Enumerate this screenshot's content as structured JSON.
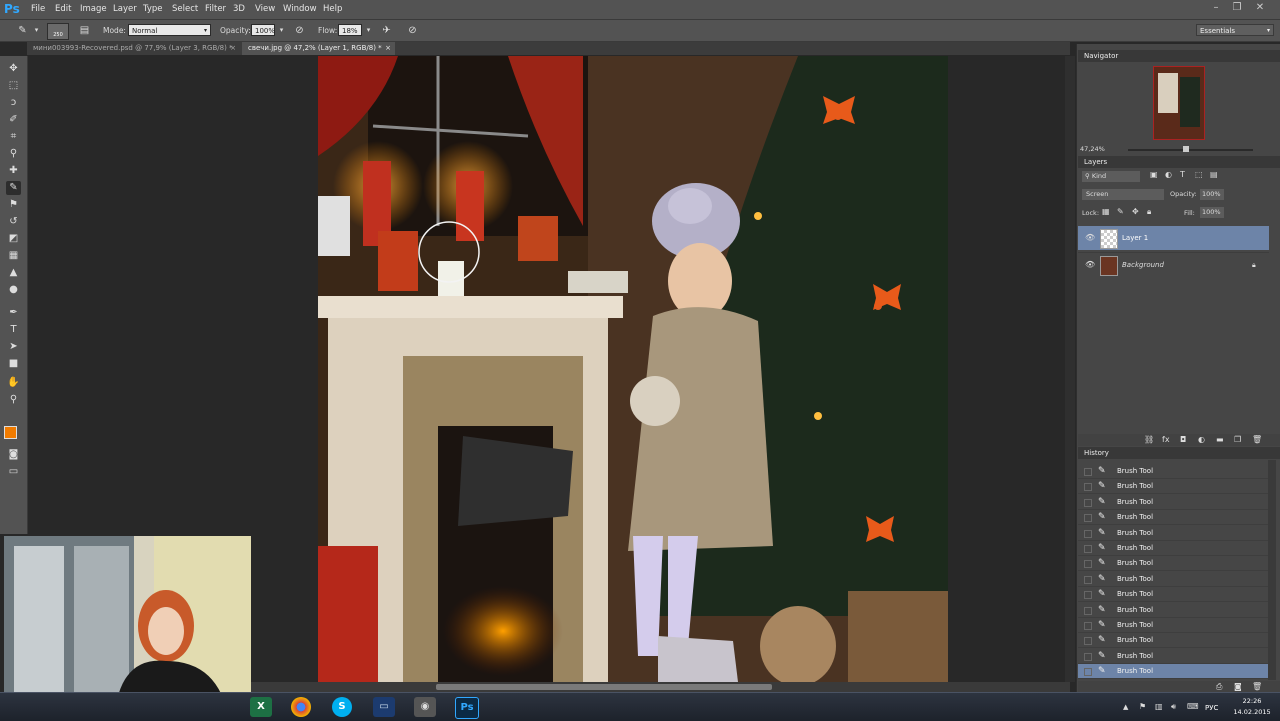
{
  "app": {
    "logo": "Ps"
  },
  "menu": [
    "File",
    "Edit",
    "Image",
    "Layer",
    "Type",
    "Select",
    "Filter",
    "3D",
    "View",
    "Window",
    "Help"
  ],
  "options": {
    "brush_size": "250",
    "mode_label": "Mode:",
    "mode_value": "Normal",
    "opacity_label": "Opacity:",
    "opacity_value": "100%",
    "flow_label": "Flow:",
    "flow_value": "18%",
    "workspace": "Essentials"
  },
  "tabs": [
    {
      "label": "мини003993-Recovered.psd @ 77,9% (Layer 3, RGB/8) *",
      "close": "×"
    },
    {
      "label": "свечи.jpg @ 47,2% (Layer 1, RGB/8) *",
      "close": "×"
    }
  ],
  "navigator": {
    "title": "Navigator",
    "zoom": "47,24%"
  },
  "layers": {
    "title": "Layers",
    "kind_label": "Kind",
    "blend_mode": "Screen",
    "opacity_label": "Opacity:",
    "opacity_value": "100%",
    "lock_label": "Lock:",
    "fill_label": "Fill:",
    "fill_value": "100%",
    "items": [
      {
        "name": "Layer 1",
        "selected": true
      },
      {
        "name": "Background",
        "selected": false
      }
    ]
  },
  "history": {
    "title": "History",
    "items": [
      "Brush Tool",
      "Brush Tool",
      "Brush Tool",
      "Brush Tool",
      "Brush Tool",
      "Brush Tool",
      "Brush Tool",
      "Brush Tool",
      "Brush Tool",
      "Brush Tool",
      "Brush Tool",
      "Brush Tool",
      "Brush Tool",
      "Brush Tool"
    ]
  },
  "colors": {
    "foreground": "#f07b00",
    "background": "#111111",
    "selection": "#6d84a8",
    "accent": "#31a8ff"
  },
  "taskbar": {
    "lang": "РУС",
    "time": "22:26",
    "date": "14.02.2015",
    "apps": [
      "excel-icon",
      "chrome-icon",
      "skype-icon",
      "monitor-icon",
      "camera-icon",
      "photoshop-icon"
    ],
    "ps_label": "Ps",
    "skype_label": "S",
    "excel_label": "X"
  }
}
